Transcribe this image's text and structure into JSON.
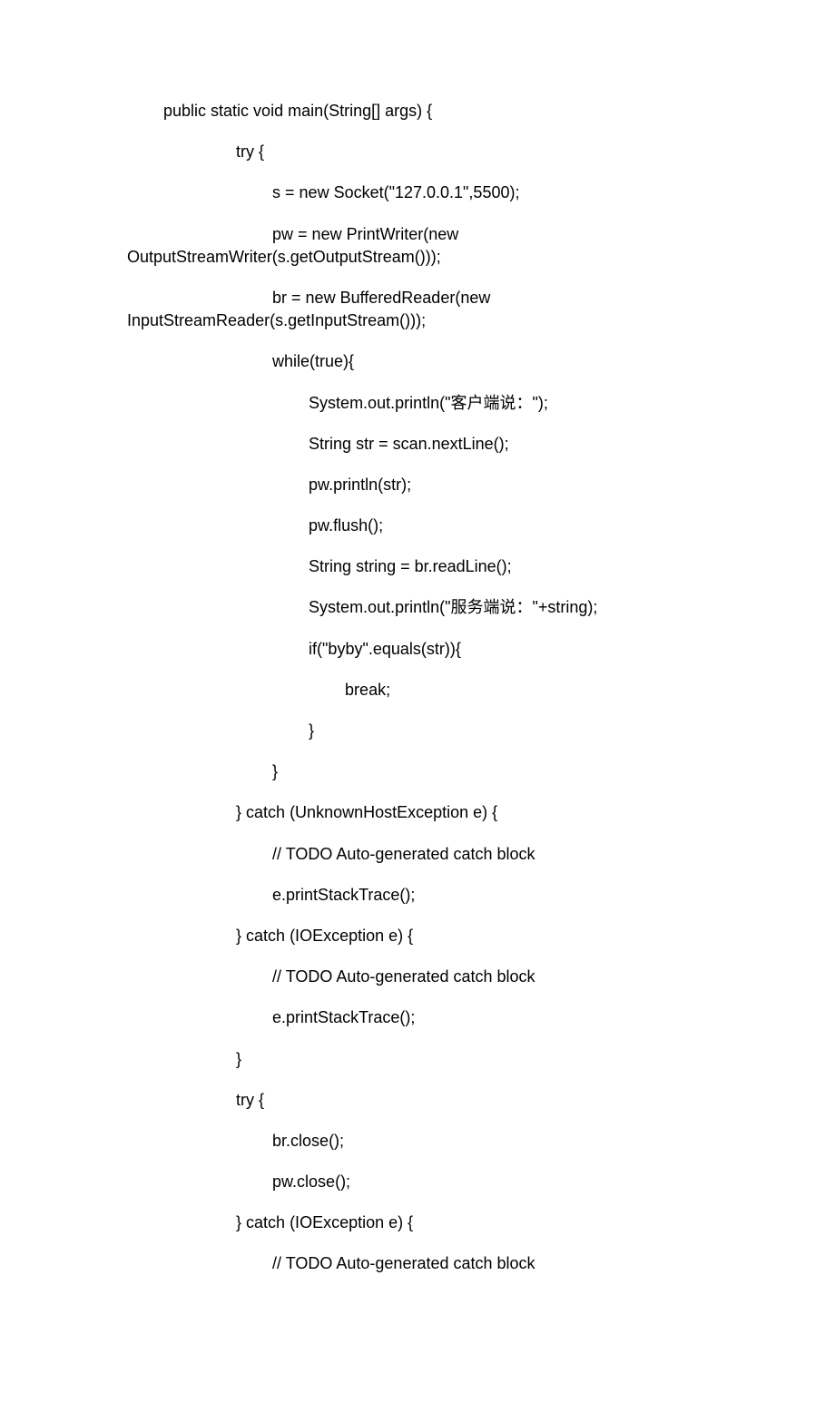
{
  "code": {
    "lines": [
      {
        "indent": "        ",
        "text": "public static void main(String[] args) {"
      },
      {
        "indent": "                        ",
        "text": "try {"
      },
      {
        "indent": "                                ",
        "text": "s = new Socket(\"127.0.0.1\",5500);"
      },
      {
        "indent": "                                ",
        "text": "pw = new PrintWriter(new OutputStreamWriter(s.getOutputStream()));",
        "wrap": true
      },
      {
        "indent": "                                ",
        "text": "br = new BufferedReader(new InputStreamReader(s.getInputStream()));",
        "wrap": true
      },
      {
        "indent": "                                ",
        "text": "while(true){"
      },
      {
        "indent": "                                        ",
        "text": "System.out.println(\"客户端说：\");"
      },
      {
        "indent": "                                        ",
        "text": "String str = scan.nextLine();"
      },
      {
        "indent": "                                        ",
        "text": "pw.println(str);"
      },
      {
        "indent": "                                        ",
        "text": "pw.flush();"
      },
      {
        "indent": "                                        ",
        "text": "String string = br.readLine();"
      },
      {
        "indent": "                                        ",
        "text": "System.out.println(\"服务端说：\"+string);"
      },
      {
        "indent": "                                        ",
        "text": "if(\"byby\".equals(str)){"
      },
      {
        "indent": "                                                ",
        "text": "break;"
      },
      {
        "indent": "                                        ",
        "text": "}"
      },
      {
        "indent": "                                ",
        "text": "}"
      },
      {
        "indent": "                        ",
        "text": "} catch (UnknownHostException e) {"
      },
      {
        "indent": "                                ",
        "text": "// TODO Auto-generated catch block"
      },
      {
        "indent": "                                ",
        "text": "e.printStackTrace();"
      },
      {
        "indent": "                        ",
        "text": "} catch (IOException e) {"
      },
      {
        "indent": "                                ",
        "text": "// TODO Auto-generated catch block"
      },
      {
        "indent": "                                ",
        "text": "e.printStackTrace();"
      },
      {
        "indent": "                        ",
        "text": "}"
      },
      {
        "indent": "                        ",
        "text": "try {"
      },
      {
        "indent": "                                ",
        "text": "br.close();"
      },
      {
        "indent": "                                ",
        "text": "pw.close();"
      },
      {
        "indent": "                        ",
        "text": "} catch (IOException e) {"
      },
      {
        "indent": "                                ",
        "text": "// TODO Auto-generated catch block"
      }
    ]
  }
}
